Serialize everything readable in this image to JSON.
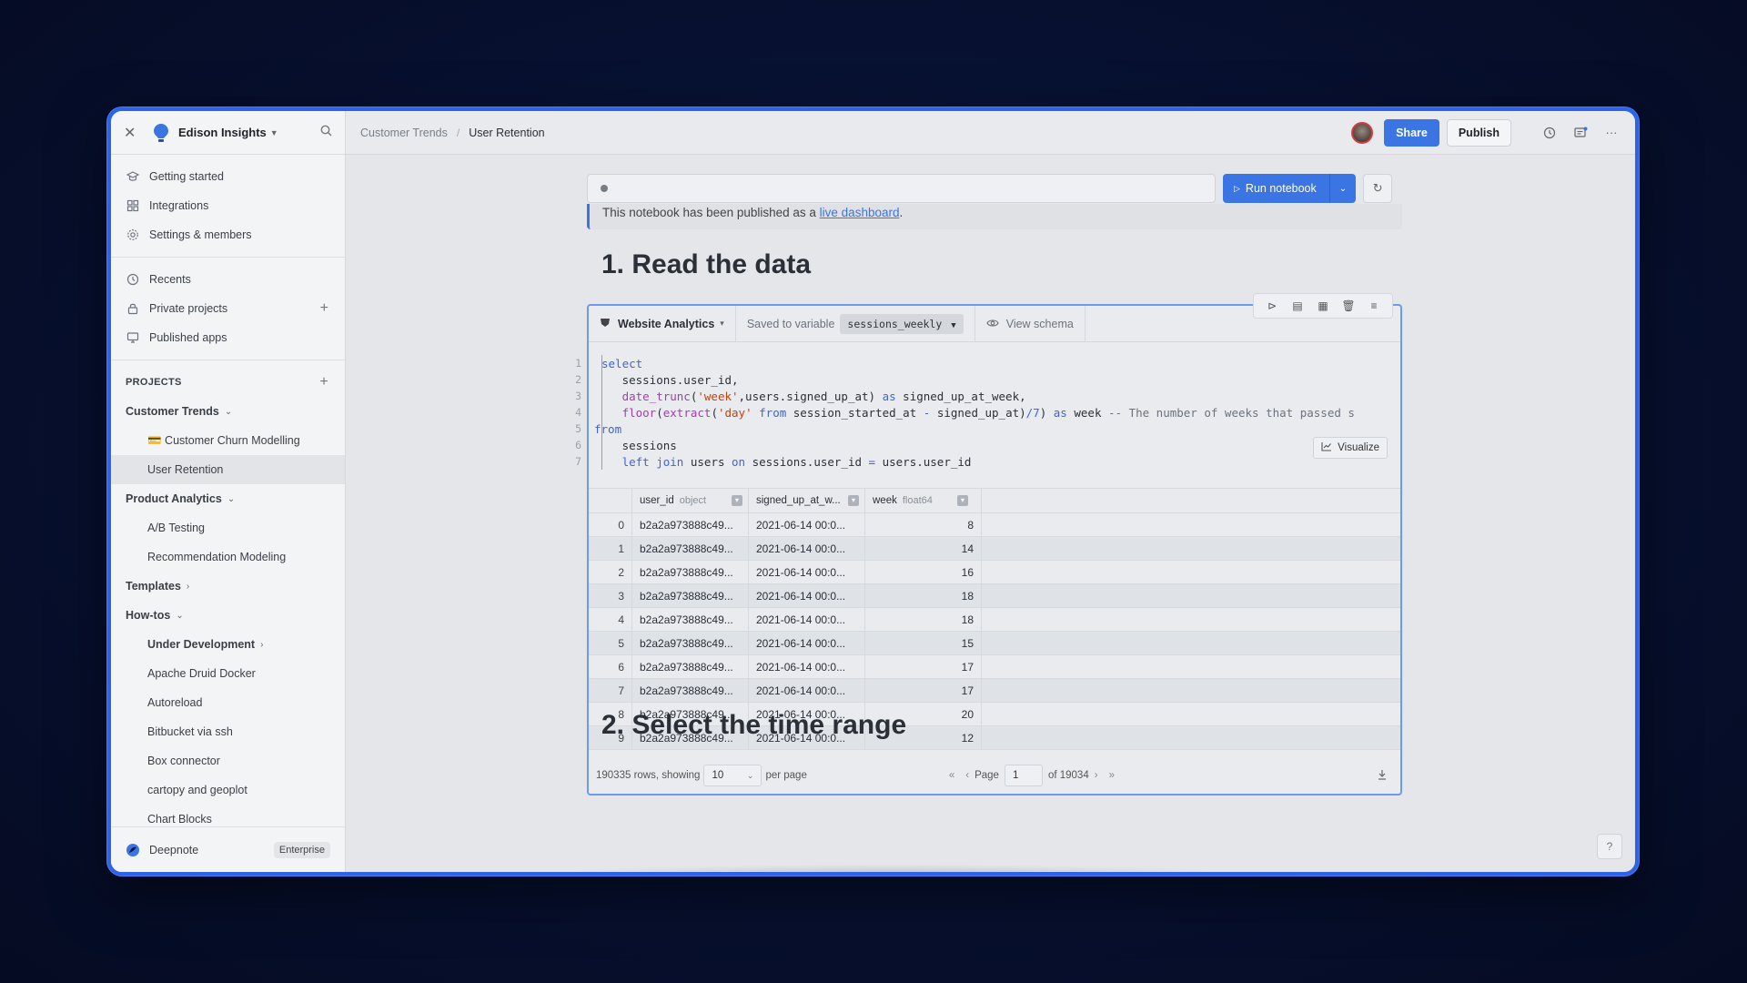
{
  "workspace": {
    "name": "Edison Insights"
  },
  "sidebar": {
    "top_items": [
      {
        "label": "Getting started",
        "icon": "graduation-icon"
      },
      {
        "label": "Integrations",
        "icon": "grid-icon"
      },
      {
        "label": "Settings & members",
        "icon": "gear-icon"
      }
    ],
    "mid_items": [
      {
        "label": "Recents",
        "icon": "clock-icon"
      },
      {
        "label": "Private projects",
        "icon": "lock-icon"
      },
      {
        "label": "Published apps",
        "icon": "monitor-icon"
      }
    ],
    "projects_title": "PROJECTS",
    "tree": {
      "customer_trends": "Customer Trends",
      "customer_churn": "💳 Customer Churn Modelling",
      "user_retention": "User Retention",
      "product_analytics": "Product Analytics",
      "ab_testing": "A/B Testing",
      "recommendation": "Recommendation Modeling",
      "templates": "Templates",
      "howtos": "How-tos",
      "under_dev": "Under Development",
      "druid": "Apache Druid Docker",
      "autoreload": "Autoreload",
      "bitbucket": "Bitbucket via ssh",
      "box": "Box connector",
      "cartopy": "cartopy and geoplot",
      "chart_blocks": "Chart Blocks"
    },
    "footer": {
      "brand": "Deepnote",
      "plan": "Enterprise"
    }
  },
  "topbar": {
    "breadcrumb_parent": "Customer Trends",
    "breadcrumb_separator": "/",
    "breadcrumb_current": "User Retention",
    "share_label": "Share",
    "publish_label": "Publish"
  },
  "notebook": {
    "run_label": "Run notebook",
    "published_prefix": "This notebook has been published as a ",
    "published_link": "live dashboard",
    "published_suffix": ".",
    "heading1": "1. Read the data",
    "heading2": "2. Select the time range",
    "cell": {
      "datasource": "Website Analytics",
      "saved_to_label": "Saved to variable",
      "variable": "sessions_weekly",
      "view_schema": "View schema",
      "visualize": "Visualize",
      "code_lines": [
        {
          "n": "1",
          "indent": 0
        },
        {
          "n": "2",
          "indent": 1
        },
        {
          "n": "3",
          "indent": 1
        },
        {
          "n": "4",
          "indent": 1
        },
        {
          "n": "5",
          "indent": 0
        },
        {
          "n": "6",
          "indent": 1
        },
        {
          "n": "7",
          "indent": 1
        }
      ],
      "columns": [
        {
          "name": "user_id",
          "type": "object"
        },
        {
          "name": "signed_up_at_w...",
          "type": ""
        },
        {
          "name": "week",
          "type": "float64"
        }
      ],
      "rows": [
        {
          "idx": "0",
          "user_id": "b2a2a973888c49...",
          "signed": "2021-06-14 00:0...",
          "week": "8"
        },
        {
          "idx": "1",
          "user_id": "b2a2a973888c49...",
          "signed": "2021-06-14 00:0...",
          "week": "14"
        },
        {
          "idx": "2",
          "user_id": "b2a2a973888c49...",
          "signed": "2021-06-14 00:0...",
          "week": "16"
        },
        {
          "idx": "3",
          "user_id": "b2a2a973888c49...",
          "signed": "2021-06-14 00:0...",
          "week": "18"
        },
        {
          "idx": "4",
          "user_id": "b2a2a973888c49...",
          "signed": "2021-06-14 00:0...",
          "week": "18"
        },
        {
          "idx": "5",
          "user_id": "b2a2a973888c49...",
          "signed": "2021-06-14 00:0...",
          "week": "15"
        },
        {
          "idx": "6",
          "user_id": "b2a2a973888c49...",
          "signed": "2021-06-14 00:0...",
          "week": "17"
        },
        {
          "idx": "7",
          "user_id": "b2a2a973888c49...",
          "signed": "2021-06-14 00:0...",
          "week": "17"
        },
        {
          "idx": "8",
          "user_id": "b2a2a973888c49...",
          "signed": "2021-06-14 00:0...",
          "week": "20"
        },
        {
          "idx": "9",
          "user_id": "b2a2a973888c49...",
          "signed": "2021-06-14 00:0...",
          "week": "12"
        }
      ],
      "footer": {
        "rows_text": "190335 rows, showing",
        "per_page_value": "10",
        "per_page_label": "per page",
        "page_label": "Page",
        "page_value": "1",
        "of_text": "of 19034"
      }
    }
  },
  "colors": {
    "accent": "#3b74e3",
    "frame": "#2d63e6"
  }
}
